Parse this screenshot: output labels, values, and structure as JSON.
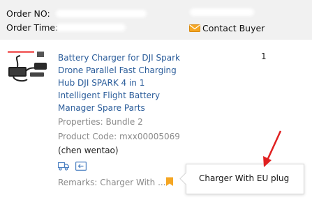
{
  "order": {
    "order_no_label": "Order NO:",
    "order_time_label": "Order Time:",
    "contact_buyer_label": "Contact Buyer",
    "contact_icon": "mail-icon"
  },
  "product": {
    "title_lines": [
      "Battery Charger for DJI Spark",
      "Drone Parallel Fast Charging",
      "Hub DJI SPARK 4 in 1",
      "Intelligent Flight Battery",
      "Manager Spare Parts"
    ],
    "quantity": "1",
    "properties": "Properties: Bundle 2",
    "product_code": "Product Code: mxx00005069",
    "seller": "(chen wentao)",
    "action_icons": [
      "truck-icon",
      "return-icon"
    ],
    "remarks_label": "Remarks: Charger With ...",
    "remarks_icon": "bookmark-icon"
  },
  "tooltip": {
    "text": "Charger With EU plug"
  },
  "colors": {
    "link": "#2a5c9a",
    "muted": "#8a8a8a",
    "header_bg": "#f1f1f1",
    "accent_orange": "#f5a623",
    "annotation_red": "#e02020"
  }
}
